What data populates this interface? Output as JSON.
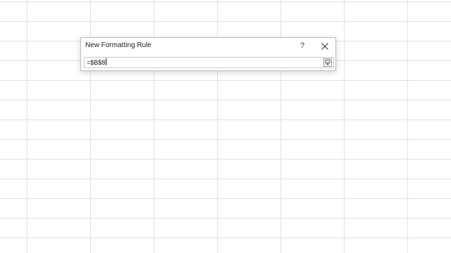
{
  "dialog": {
    "title": "New Formatting Rule",
    "help_label": "?",
    "close_icon": "close-icon",
    "reference_value": "=$B$8",
    "expand_icon": "expand-dialog-icon"
  },
  "colors": {
    "gridline": "#e1e1e1",
    "dialog_border": "#bdbdbd",
    "text": "#222222"
  }
}
